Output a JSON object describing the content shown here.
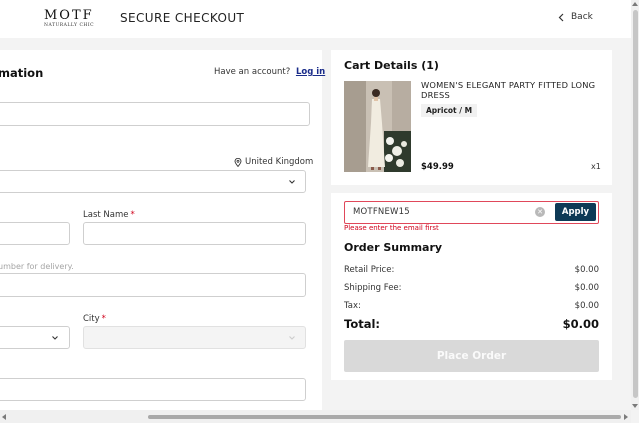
{
  "header": {
    "logo_main": "MOTF",
    "logo_sub": "NATURALLY CHIC",
    "title": "SECURE CHECKOUT",
    "back_label": "Back"
  },
  "form": {
    "section_title": "mation",
    "have_account": "Have an account?",
    "login_label": "Log in",
    "country": "United Kingdom",
    "last_name_label": "Last Name",
    "required_mark": "*",
    "phone_hint": "umber for delivery.",
    "city_label": "City"
  },
  "cart": {
    "title": "Cart Details (1)",
    "product_name": "WOMEN'S ELEGANT PARTY FITTED LONG DRESS",
    "variant": "Apricot / M",
    "price": "$49.99",
    "quantity": "x1"
  },
  "coupon": {
    "value": "MOTFNEW15",
    "apply_label": "Apply",
    "error": "Please enter the email first"
  },
  "summary": {
    "title": "Order Summary",
    "rows": [
      {
        "label": "Retail Price:",
        "value": "$0.00"
      },
      {
        "label": "Shipping Fee:",
        "value": "$0.00"
      },
      {
        "label": "Tax:",
        "value": "$0.00"
      }
    ],
    "total_label": "Total:",
    "total_value": "$0.00",
    "place_order_label": "Place Order"
  },
  "colors": {
    "accent": "#0e3a56",
    "error": "#d0021b",
    "link": "#1a2c8a"
  }
}
